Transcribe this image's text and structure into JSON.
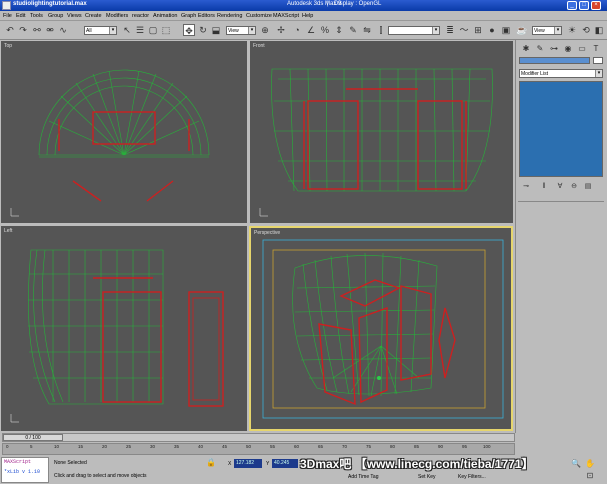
{
  "window": {
    "file_title": "studiolightingtutorial.max",
    "app_name": "Autodesk 3ds Max 9",
    "separator": "|",
    "display_mode": "Display : OpenGL",
    "minimize": "_",
    "maximize": "□",
    "close": "×"
  },
  "menu": [
    "File",
    "Edit",
    "Tools",
    "Group",
    "Views",
    "Create",
    "Modifiers",
    "reactor",
    "Animation",
    "Graph Editors",
    "Rendering",
    "Customize",
    "MAXScript",
    "Help"
  ],
  "toolbar": {
    "selection_filter": "All",
    "reference_coord": "View",
    "named_selection": "View"
  },
  "viewports": [
    {
      "label": "Top",
      "active": false
    },
    {
      "label": "Front",
      "active": false
    },
    {
      "label": "Left",
      "active": false
    },
    {
      "label": "Perspective",
      "active": true
    }
  ],
  "command_panel": {
    "modifier_list": "Modifier List"
  },
  "timeline": {
    "frame": "0 / 100",
    "ticks": [
      "0",
      "5",
      "10",
      "15",
      "20",
      "25",
      "30",
      "35",
      "40",
      "45",
      "50",
      "55",
      "60",
      "65",
      "70",
      "75",
      "80",
      "85",
      "90",
      "95",
      "100"
    ]
  },
  "status": {
    "maxscript_line1": "MAXScript",
    "maxscript_line2": "*xLib v 1.10",
    "selection": "None Selected",
    "prompt": "Click and drag to select and move objects",
    "x_label": "X",
    "x_value": "127.182",
    "y_label": "Y",
    "y_value": "40.245",
    "add_time_tag": "Add Time Tag",
    "set_key": "Set Key",
    "key_filters": "Key Filters..."
  },
  "watermark": "3Dmax吧 【www.linecg.com/tieba/1771】",
  "colors": {
    "title_bar": "#0a3aa8",
    "viewport_bg": "#555555",
    "wire_green": "#27b23a",
    "wire_red": "#cc2020",
    "active_border": "#e6d56c",
    "panel_blue": "#2b6fb0"
  }
}
